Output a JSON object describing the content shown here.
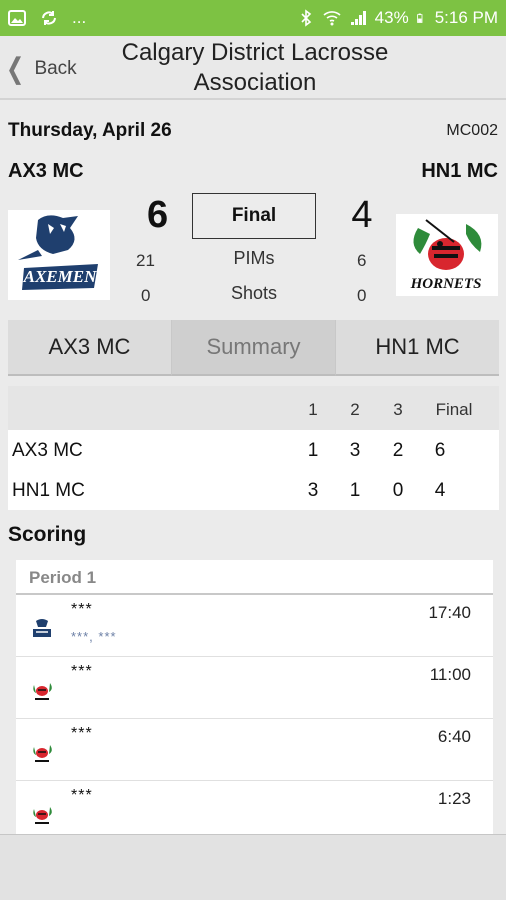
{
  "status": {
    "battery": "43%",
    "time": "5:16 PM",
    "more": "..."
  },
  "header": {
    "back_label": "Back",
    "title": "Calgary District Lacrosse Association"
  },
  "game": {
    "date": "Thursday, April 26",
    "code": "MC002",
    "status": "Final",
    "home": {
      "name": "AX3 MC",
      "score": "6",
      "pims": "21",
      "shots": "0",
      "logo_text": "AXEMEN"
    },
    "away": {
      "name": "HN1 MC",
      "score": "4",
      "pims": "6",
      "shots": "0",
      "logo_text": "HORNETS"
    },
    "pims_label": "PIMs",
    "shots_label": "Shots"
  },
  "tabs": [
    {
      "label": "AX3 MC"
    },
    {
      "label": "Summary"
    },
    {
      "label": "HN1 MC"
    }
  ],
  "box_score": {
    "headers": [
      "1",
      "2",
      "3",
      "Final"
    ],
    "rows": [
      {
        "team": "AX3 MC",
        "values": [
          "1",
          "3",
          "2",
          "6"
        ]
      },
      {
        "team": "HN1 MC",
        "values": [
          "3",
          "1",
          "0",
          "4"
        ]
      }
    ]
  },
  "scoring": {
    "title": "Scoring",
    "period_label": "Period 1",
    "goals": [
      {
        "team": "axemen",
        "scorer": "***",
        "assists": "***, ***",
        "time": "17:40"
      },
      {
        "team": "hornets",
        "scorer": "***",
        "assists": "",
        "time": "11:00"
      },
      {
        "team": "hornets",
        "scorer": "***",
        "assists": "",
        "time": "6:40"
      },
      {
        "team": "hornets",
        "scorer": "***",
        "assists": "",
        "time": "1:23"
      }
    ]
  },
  "colors": {
    "status_bar": "#7dc243",
    "axemen_blue": "#1f3f6e",
    "hornets_green": "#2e8b3a",
    "hornets_red": "#d8262e"
  }
}
